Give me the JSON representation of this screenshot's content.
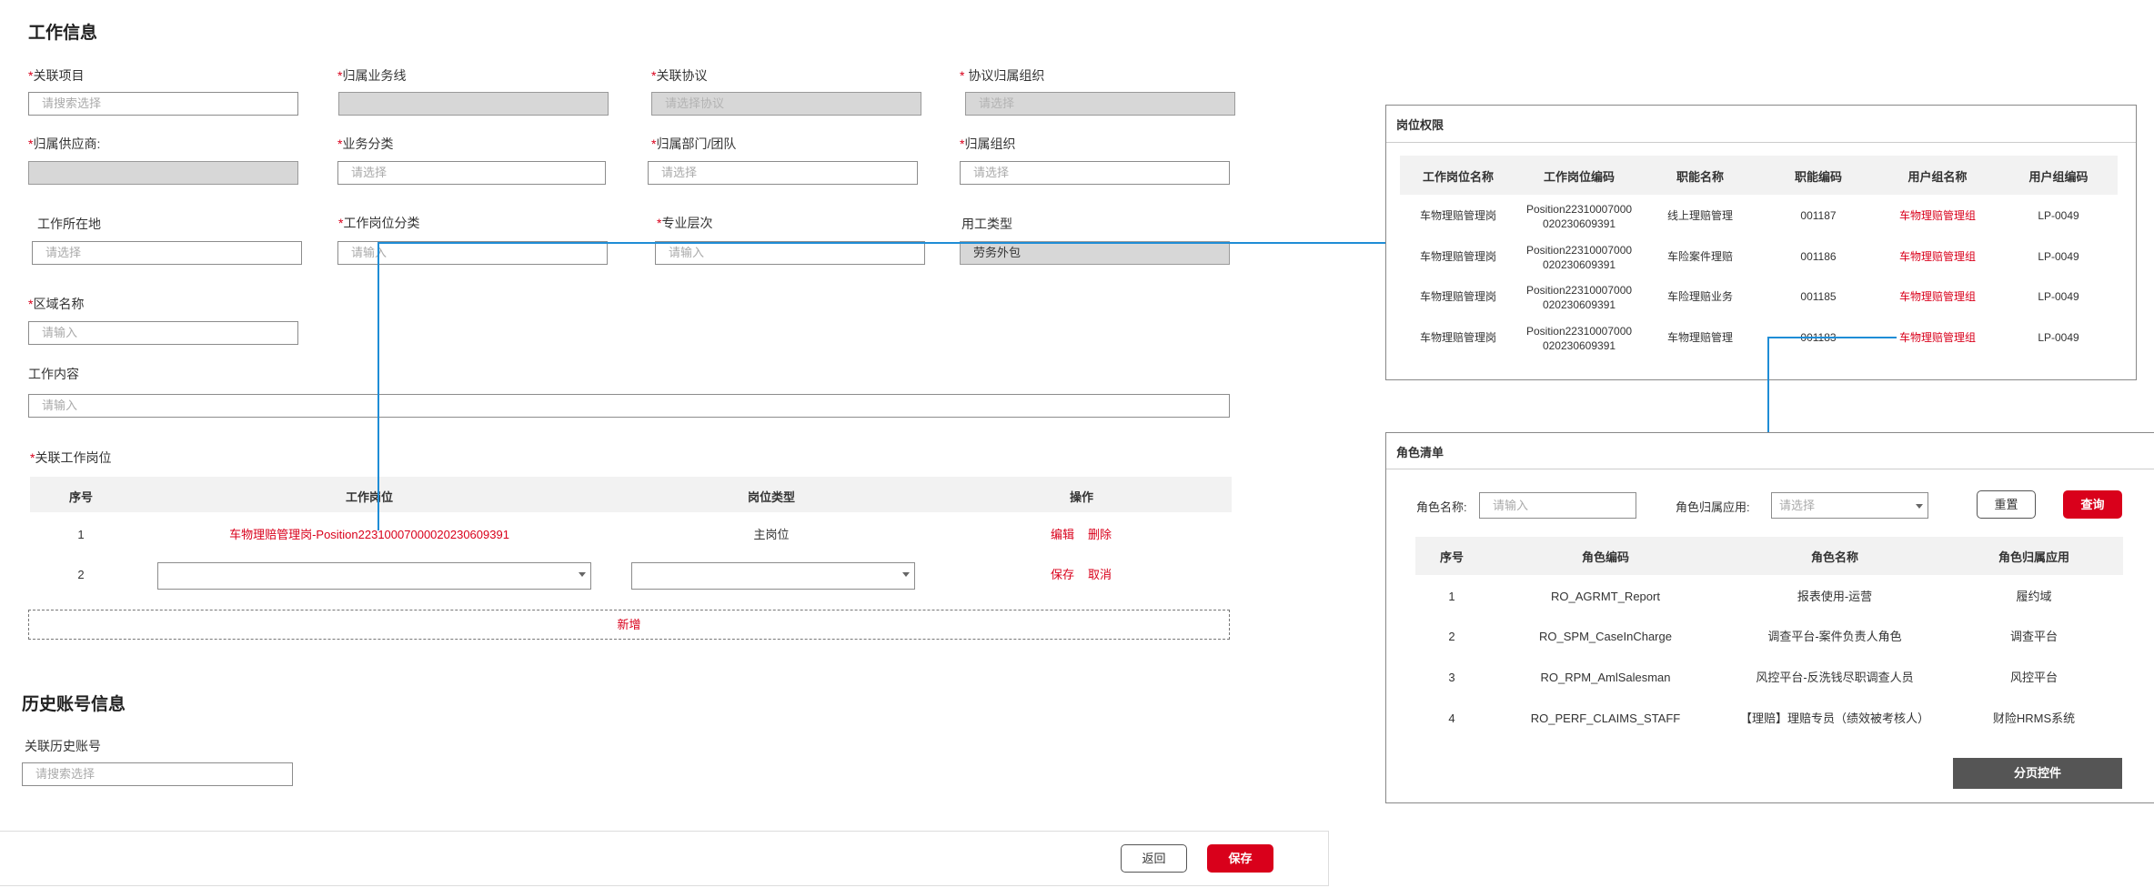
{
  "work": {
    "title": "工作信息",
    "related_project": {
      "label": "关联项目",
      "placeholder": "请搜索选择"
    },
    "business_line": {
      "label": "归属业务线"
    },
    "related_agreement": {
      "label": "关联协议",
      "placeholder": "请选择协议"
    },
    "agreement_org": {
      "label": "协议归属组织",
      "placeholder": "请选择"
    },
    "supplier": {
      "label": "归属供应商:"
    },
    "business_class": {
      "label": "业务分类",
      "placeholder": "请选择"
    },
    "dept_team": {
      "label": "归属部门/团队",
      "placeholder": "请选择"
    },
    "org": {
      "label": "归属组织",
      "placeholder": "请选择"
    },
    "location": {
      "label": "工作所在地",
      "placeholder": "请选择"
    },
    "position_class": {
      "label": "工作岗位分类",
      "placeholder": "请输入"
    },
    "professional_level": {
      "label": "专业层次",
      "placeholder": "请输入"
    },
    "employment_type": {
      "label": "用工类型",
      "value": "劳务外包"
    },
    "area_name": {
      "label": "区域名称",
      "placeholder": "请输入"
    },
    "work_content": {
      "label": "工作内容",
      "placeholder": "请输入"
    }
  },
  "positions": {
    "title": "关联工作岗位",
    "headers": [
      "序号",
      "工作岗位",
      "岗位类型",
      "操作"
    ],
    "row1": {
      "no": "1",
      "position": "车物理赔管理岗-Position22310007000020230609391",
      "type": "主岗位",
      "edit": "编辑",
      "delete": "删除"
    },
    "row2": {
      "no": "2",
      "save": "保存",
      "cancel": "取消"
    },
    "add_label": "新增"
  },
  "history": {
    "title": "历史账号信息",
    "label": "关联历史账号",
    "placeholder": "请搜索选择"
  },
  "footer": {
    "back": "返回",
    "save": "保存"
  },
  "perm_panel": {
    "title": "岗位权限",
    "headers": [
      "工作岗位名称",
      "工作岗位编码",
      "职能名称",
      "职能编码",
      "用户组名称",
      "用户组编码"
    ],
    "rows": [
      {
        "name": "车物理赔管理岗",
        "code1": "Position22310007000",
        "code2": "020230609391",
        "func": "线上理赔管理",
        "func_code": "001187",
        "group": "车物理赔管理组",
        "group_code": "LP-0049"
      },
      {
        "name": "车物理赔管理岗",
        "code1": "Position22310007000",
        "code2": "020230609391",
        "func": "车险案件理赔",
        "func_code": "001186",
        "group": "车物理赔管理组",
        "group_code": "LP-0049"
      },
      {
        "name": "车物理赔管理岗",
        "code1": "Position22310007000",
        "code2": "020230609391",
        "func": "车险理赔业务",
        "func_code": "001185",
        "group": "车物理赔管理组",
        "group_code": "LP-0049"
      },
      {
        "name": "车物理赔管理岗",
        "code1": "Position22310007000",
        "code2": "020230609391",
        "func": "车物理赔管理",
        "func_code": "001183",
        "group": "车物理赔管理组",
        "group_code": "LP-0049"
      }
    ]
  },
  "role_panel": {
    "title": "角色清单",
    "role_name_label": "角色名称:",
    "role_name_placeholder": "请输入",
    "role_app_label": "角色归属应用:",
    "role_app_placeholder": "请选择",
    "reset": "重置",
    "query": "查询",
    "headers": [
      "序号",
      "角色编码",
      "角色名称",
      "角色归属应用"
    ],
    "rows": [
      {
        "no": "1",
        "code": "RO_AGRMT_Report",
        "name": "报表使用-运营",
        "app": "履约域"
      },
      {
        "no": "2",
        "code": "RO_SPM_CaseInCharge",
        "name": "调查平台-案件负责人角色",
        "app": "调查平台"
      },
      {
        "no": "3",
        "code": "RO_RPM_AmlSalesman",
        "name": "风控平台-反洗钱尽职调查人员",
        "app": "风控平台"
      },
      {
        "no": "4",
        "code": "RO_PERF_CLAIMS_STAFF",
        "name": "【理赔】理赔专员（绩效被考核人）",
        "app": "财险HRMS系统"
      }
    ],
    "pagination": "分页控件"
  },
  "colors": {
    "accent": "#d9001b",
    "connector": "#1f8dd6"
  }
}
